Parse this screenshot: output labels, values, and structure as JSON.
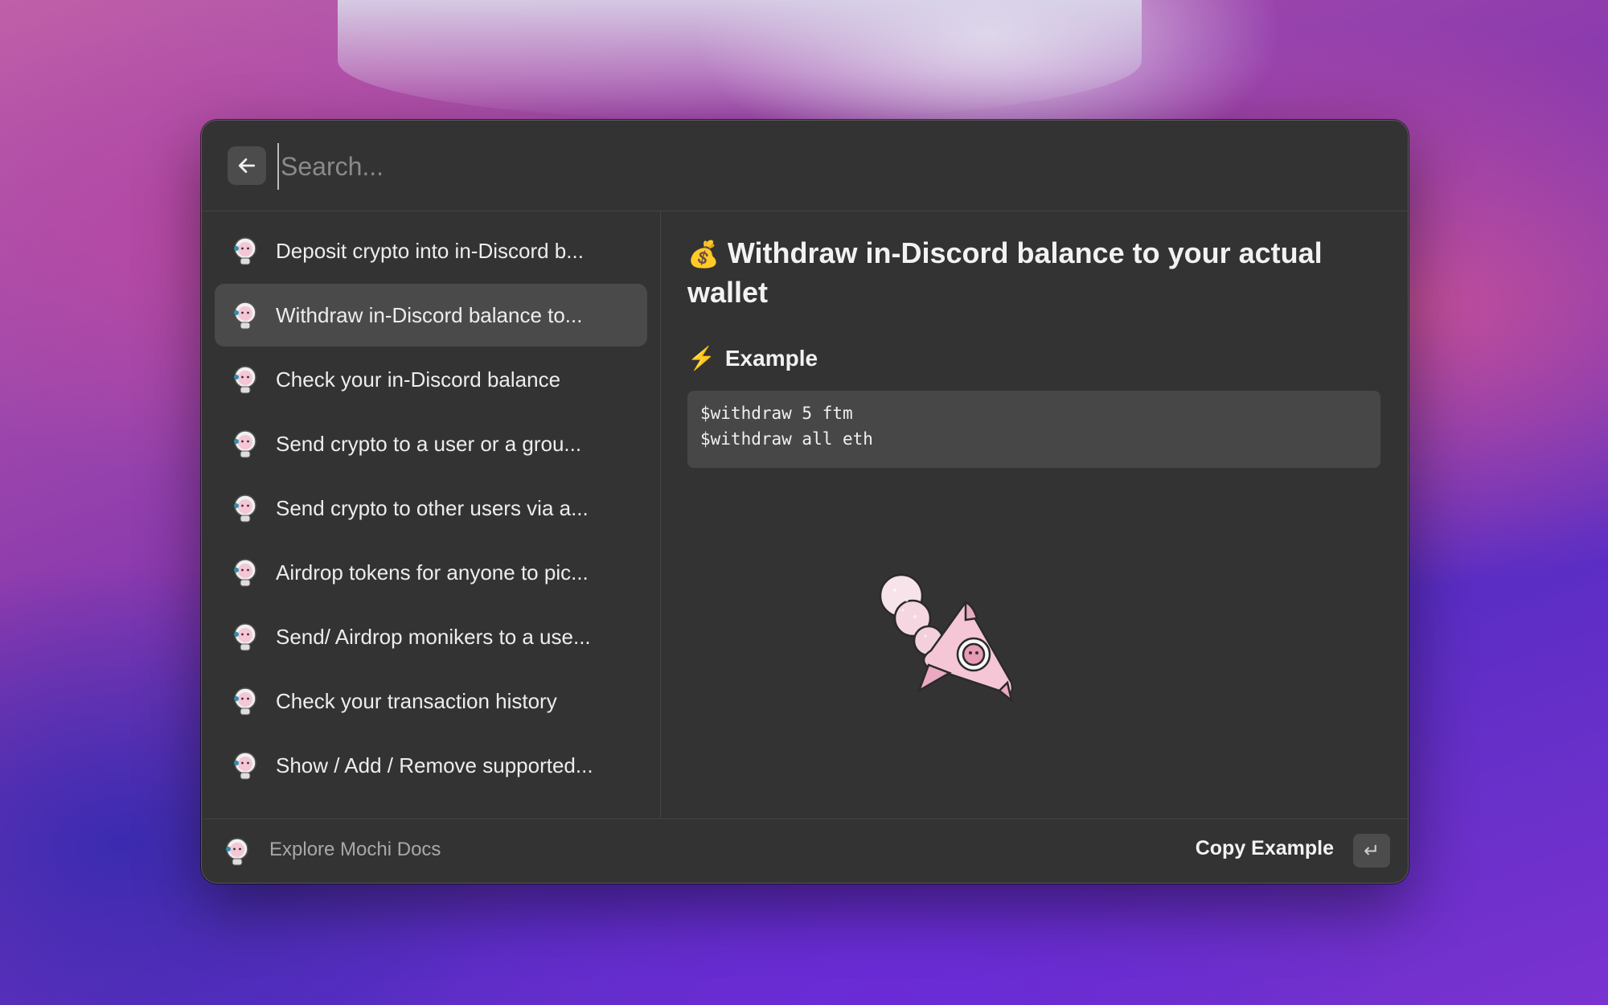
{
  "search": {
    "placeholder": "Search..."
  },
  "commands": [
    {
      "label": "Deposit crypto into in-Discord b...",
      "icon": "mochi-icon",
      "selected": false
    },
    {
      "label": "Withdraw in-Discord balance to...",
      "icon": "mochi-icon",
      "selected": true
    },
    {
      "label": "Check your in-Discord balance",
      "icon": "mochi-icon",
      "selected": false
    },
    {
      "label": "Send crypto to a user or a grou...",
      "icon": "mochi-icon",
      "selected": false
    },
    {
      "label": "Send crypto to other users via a...",
      "icon": "mochi-icon",
      "selected": false
    },
    {
      "label": "Airdrop tokens for anyone to pic...",
      "icon": "mochi-icon",
      "selected": false
    },
    {
      "label": "Send/ Airdrop monikers to a use...",
      "icon": "mochi-icon",
      "selected": false
    },
    {
      "label": "Check your transaction history",
      "icon": "mochi-icon",
      "selected": false
    },
    {
      "label": "Show / Add / Remove supported...",
      "icon": "mochi-icon",
      "selected": false
    }
  ],
  "detail": {
    "title_emoji": "💰",
    "title": "Withdraw in-Discord balance to your actual wallet",
    "example_emoji": "⚡",
    "example_heading": "Example",
    "code_lines": [
      "$withdraw 5 ftm",
      "$withdraw all eth"
    ]
  },
  "footer": {
    "link_label": "Explore Mochi Docs",
    "action_label": "Copy Example",
    "action_key": "↵"
  },
  "colors": {
    "window_bg": "#333333",
    "selected_bg": "#4a4a4a",
    "code_bg": "#474747",
    "accent_pink": "#f4c6d6"
  }
}
